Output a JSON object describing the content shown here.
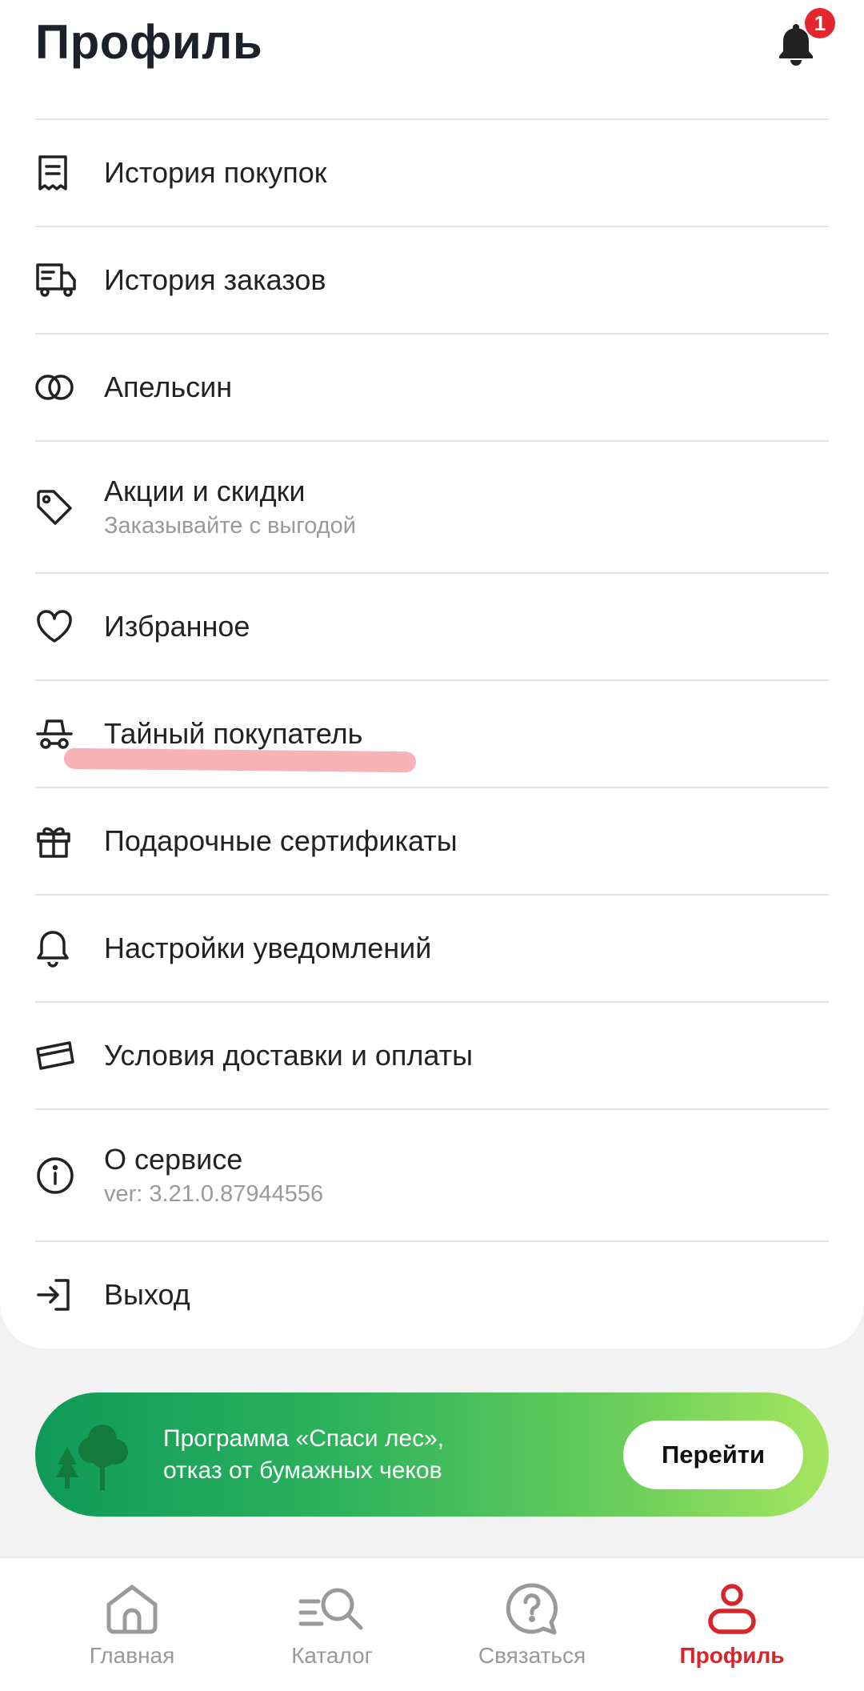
{
  "header": {
    "title": "Профиль",
    "notification_count": "1"
  },
  "menu": [
    {
      "label": "История покупок",
      "icon": "receipt-icon"
    },
    {
      "label": "История заказов",
      "icon": "delivery-truck-icon"
    },
    {
      "label": "Апельсин",
      "icon": "rings-icon"
    },
    {
      "label": "Акции и скидки",
      "sub": "Заказывайте с выгодой",
      "icon": "tag-icon"
    },
    {
      "label": "Избранное",
      "icon": "heart-icon"
    },
    {
      "label": "Тайный покупатель",
      "icon": "secret-shopper-icon"
    },
    {
      "label": "Подарочные сертификаты",
      "icon": "gift-icon"
    },
    {
      "label": "Настройки уведомлений",
      "icon": "bell-icon"
    },
    {
      "label": "Условия доставки и оплаты",
      "icon": "card-icon"
    },
    {
      "label": "О сервисе",
      "sub": "ver: 3.21.0.87944556",
      "icon": "info-icon"
    },
    {
      "label": "Выход",
      "icon": "logout-icon"
    }
  ],
  "promo": {
    "line1": "Программа «Спаси лес»,",
    "line2": "отказ от бумажных чеков",
    "button": "Перейти"
  },
  "tabbar": [
    {
      "label": "Главная",
      "icon": "home-icon"
    },
    {
      "label": "Каталог",
      "icon": "catalog-search-icon"
    },
    {
      "label": "Связаться",
      "icon": "help-chat-icon"
    },
    {
      "label": "Профиль",
      "icon": "profile-icon",
      "active": true
    }
  ],
  "colors": {
    "accent": "#d7262b",
    "badge": "#e3262b",
    "highlight": "#f7a6ab"
  }
}
